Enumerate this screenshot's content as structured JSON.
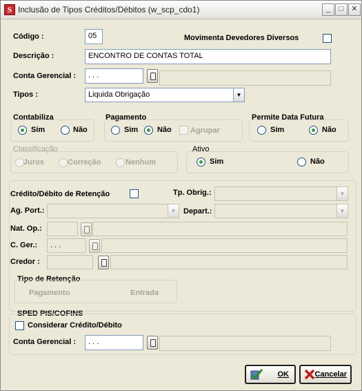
{
  "window": {
    "title": "Inclusão de Tipos Créditos/Débitos (w_scp_cdo1)",
    "icon_letter": "S",
    "min": "_",
    "max": "□",
    "close": "✕"
  },
  "form": {
    "codigo_label": "Código :",
    "codigo_value": "05",
    "movimenta_label": "Movimenta Devedores Diversos",
    "descricao_label": "Descrição :",
    "descricao_value": "ENCONTRO DE CONTAS TOTAL",
    "conta_label": "Conta Gerencial :",
    "conta_value": ". . .",
    "tipos_label": "Tipos :",
    "tipos_value": "Liquida Obrigação"
  },
  "contabiliza": {
    "label": "Contabiliza",
    "sim": "Sim",
    "nao": "Não"
  },
  "pagamento": {
    "label": "Pagamento",
    "sim": "Sim",
    "nao": "Não",
    "agrupar": "Agrupar"
  },
  "data_futura": {
    "label": "Permite Data Futura",
    "sim": "Sim",
    "nao": "Não"
  },
  "classificacao": {
    "label": "Classificação",
    "juros": "Juros",
    "correcao": "Correção",
    "nenhum": "Nenhum"
  },
  "ativo": {
    "label": "Ativo",
    "sim": "Sim",
    "nao": "Não"
  },
  "retencao": {
    "credito_label": "Crédito/Débito de Retenção",
    "tp_obrig_label": "Tp. Obrig.:",
    "ag_port_label": "Ag. Port.:",
    "depart_label": "Depart.:",
    "nat_op_label": "Nat. Op.:",
    "c_ger_label": "C. Ger.:",
    "c_ger_value": ". . .",
    "credor_label": "Credor :"
  },
  "tipo_retencao": {
    "label": "Tipo de Retenção",
    "pagamento": "Pagamento",
    "entrada": "Entrada"
  },
  "sped": {
    "label": "SPED PIS/COFINS",
    "considerar": "Considerar Crédito/Débito",
    "conta_label": "Conta Gerencial :",
    "conta_value": ". . ."
  },
  "buttons": {
    "ok": "OK",
    "cancelar": "Cancelar"
  }
}
